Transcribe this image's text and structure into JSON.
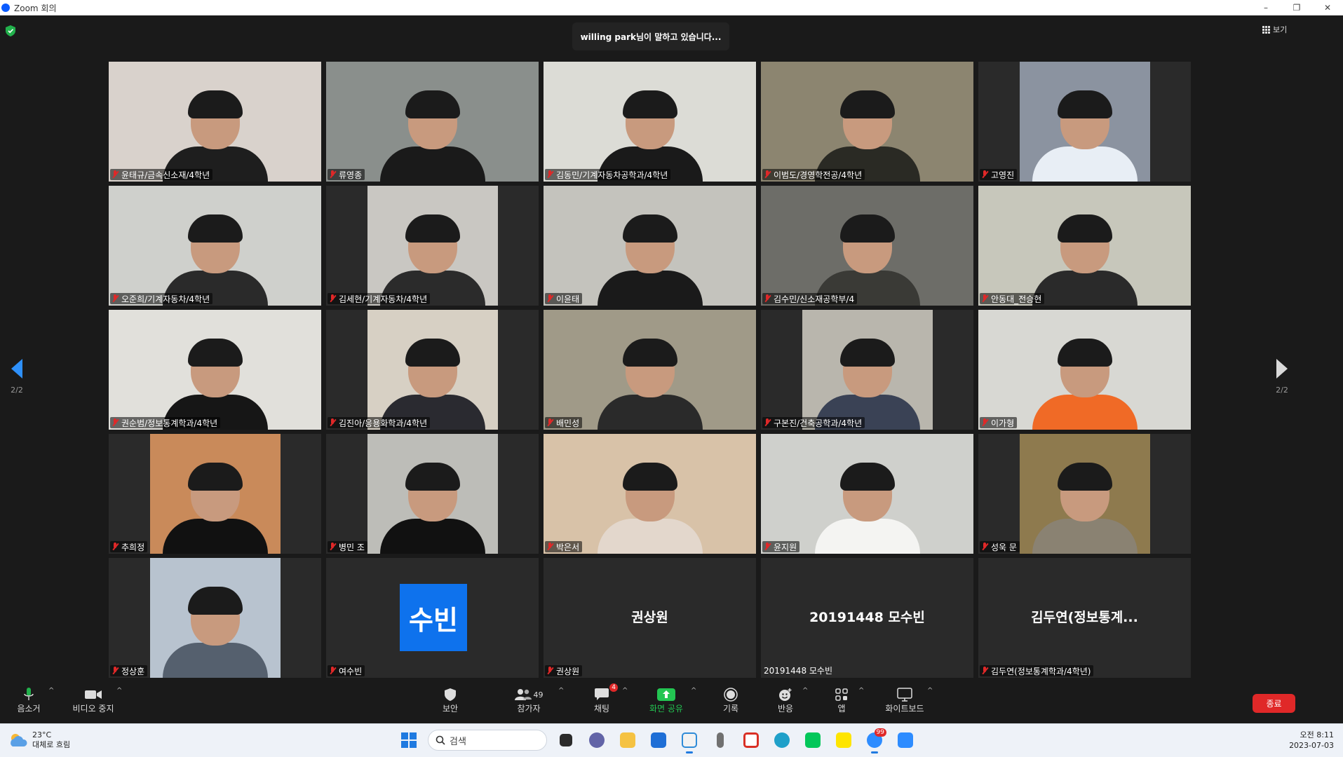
{
  "window": {
    "title": "Zoom 회의",
    "controls": [
      "–",
      "❐",
      "✕"
    ]
  },
  "meeting": {
    "speaking_banner": "willing park님이 말하고 있습니다...",
    "view_label": "보기",
    "page_indicator_left": "2/2",
    "page_indicator_right": "2/2"
  },
  "participants": [
    {
      "name": "윤태규/금속신소재/4학년",
      "muted": true,
      "video": "full",
      "bg": "#d9d2cc",
      "shirt": "#1e1e1e"
    },
    {
      "name": "류영종",
      "muted": true,
      "video": "full",
      "bg": "#8a8f8c",
      "shirt": "#1a1a1a"
    },
    {
      "name": "김동민/기계자동차공학과/4학년",
      "muted": true,
      "video": "full",
      "bg": "#dcdcd6",
      "shirt": "#1a1a1a"
    },
    {
      "name": "이범도/경영학전공/4학년",
      "muted": true,
      "video": "full",
      "bg": "#8c8570",
      "shirt": "#2a2a24"
    },
    {
      "name": "고영진",
      "muted": true,
      "video": "pillar",
      "bg": "#8b93a0",
      "shirt": "#e8eef5"
    },
    {
      "name": "오준희/기계자동차/4학년",
      "muted": true,
      "video": "full",
      "bg": "#cfd0cc",
      "shirt": "#2a2a2a"
    },
    {
      "name": "김세현/기계자동차/4학년",
      "muted": true,
      "video": "pillar",
      "bg": "#c9c7c2",
      "shirt": "#2b2b2b"
    },
    {
      "name": "이윤태",
      "muted": true,
      "video": "full",
      "bg": "#c4c3bd",
      "shirt": "#1a1a1a"
    },
    {
      "name": "김수민/신소재공학부/4",
      "muted": true,
      "video": "full",
      "bg": "#6d6d68",
      "shirt": "#3a3a36"
    },
    {
      "name": "안동대_전승현",
      "muted": true,
      "video": "full",
      "bg": "#c7c7bb",
      "shirt": "#2a2a2a"
    },
    {
      "name": "권순범/정보통계학과/4학년",
      "muted": true,
      "video": "full",
      "bg": "#e1e0db",
      "shirt": "#161616"
    },
    {
      "name": "김진아/응용화학과/4학년",
      "muted": true,
      "video": "pillar",
      "bg": "#d7d0c4",
      "shirt": "#2a2a30"
    },
    {
      "name": "배민성",
      "muted": true,
      "video": "full",
      "bg": "#a09a88",
      "shirt": "#2a2a2a"
    },
    {
      "name": "구본진/건축공학과/4학년",
      "muted": true,
      "video": "pillar",
      "bg": "#b9b6ad",
      "shirt": "#3a4255"
    },
    {
      "name": "이가형",
      "muted": true,
      "video": "full",
      "bg": "#d8d8d3",
      "shirt": "#f06a26"
    },
    {
      "name": "추희정",
      "muted": true,
      "video": "pillar",
      "bg": "#c98a5a",
      "shirt": "#111111"
    },
    {
      "name": "병민 조",
      "muted": true,
      "video": "pillar",
      "bg": "#bdbdb8",
      "shirt": "#111111"
    },
    {
      "name": "박은서",
      "muted": true,
      "video": "full",
      "bg": "#d8c2a8",
      "shirt": "#e3d7cc"
    },
    {
      "name": "윤지원",
      "muted": true,
      "video": "full",
      "bg": "#cfd0cc",
      "shirt": "#f4f4f2"
    },
    {
      "name": "성욱 문",
      "muted": true,
      "video": "pillar",
      "bg": "#8e7a4e",
      "shirt": "#8a8272"
    },
    {
      "name": "정상훈",
      "muted": true,
      "video": "pillar",
      "bg": "#b8c3cf",
      "shirt": "#55606e"
    },
    {
      "name": "여수빈",
      "muted": true,
      "video": "avatar",
      "initials": "수빈"
    },
    {
      "name": "권상원",
      "muted": true,
      "video": "none",
      "display": "권상원"
    },
    {
      "name": "20191448 모수빈",
      "muted": false,
      "video": "none",
      "display": "20191448 모수빈"
    },
    {
      "name": "김두연(정보통계학과/4학년)",
      "muted": true,
      "video": "none",
      "display": "김두연(정보통계..."
    }
  ],
  "toolbar": {
    "mute": "음소거",
    "video": "비디오 중지",
    "security": "보안",
    "participants": "참가자",
    "participants_count": "49",
    "chat": "채팅",
    "chat_badge": "4",
    "share": "화면 공유",
    "record": "기록",
    "reactions": "반응",
    "apps": "앱",
    "whiteboard": "화이트보드",
    "end": "종료"
  },
  "taskbar": {
    "temperature": "23°C",
    "weather": "대체로 흐림",
    "search_placeholder": "검색",
    "zoom_badge": "99",
    "time": "오전 8:11",
    "date": "2023-07-03"
  },
  "colors": {
    "accent": "#0e72ed",
    "share_green": "#23c552",
    "end_red": "#e02828"
  }
}
